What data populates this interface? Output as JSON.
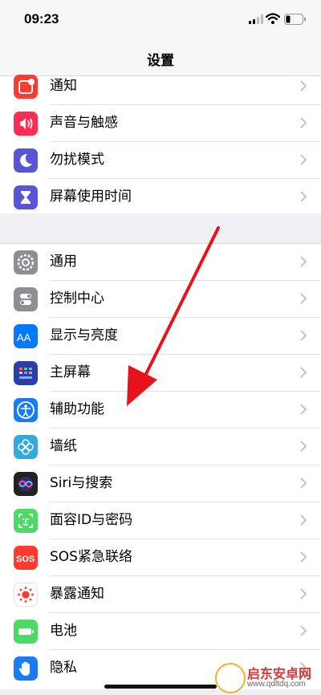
{
  "status_bar": {
    "time": "09:23"
  },
  "nav": {
    "title": "设置"
  },
  "group_top": [
    {
      "label": "通知",
      "icon": "notifications-icon",
      "color": "#ff3b30"
    },
    {
      "label": "声音与触感",
      "icon": "sound-icon",
      "color": "#ff2d55"
    },
    {
      "label": "勿扰模式",
      "icon": "moon-icon",
      "color": "#5856d6"
    },
    {
      "label": "屏幕使用时间",
      "icon": "hourglass-icon",
      "color": "#5856d6"
    }
  ],
  "group_main": [
    {
      "label": "通用",
      "icon": "gear-icon",
      "color": "#8e8e93"
    },
    {
      "label": "控制中心",
      "icon": "toggles-icon",
      "color": "#8e8e93"
    },
    {
      "label": "显示与亮度",
      "icon": "text-size-icon",
      "color": "#007aff"
    },
    {
      "label": "主屏幕",
      "icon": "home-grid-icon",
      "color": "#2c3fa8"
    },
    {
      "label": "辅助功能",
      "icon": "accessibility-icon",
      "color": "#1a7cf5"
    },
    {
      "label": "墙纸",
      "icon": "flower-icon",
      "color": "#34aadc"
    },
    {
      "label": "Siri与搜索",
      "icon": "siri-icon",
      "color": "#222222"
    },
    {
      "label": "面容ID与密码",
      "icon": "face-id-icon",
      "color": "#4cd964"
    },
    {
      "label": "SOS紧急联络",
      "icon": "sos-icon",
      "color": "#ff3b30"
    },
    {
      "label": "暴露通知",
      "icon": "exposure-icon",
      "color": "#ffffff"
    },
    {
      "label": "电池",
      "icon": "battery-icon",
      "color": "#4cd964"
    },
    {
      "label": "隐私",
      "icon": "hand-icon",
      "color": "#1a7cf5"
    }
  ],
  "watermark": {
    "title": "启东安卓网",
    "url": "www.qdltdq.com"
  }
}
